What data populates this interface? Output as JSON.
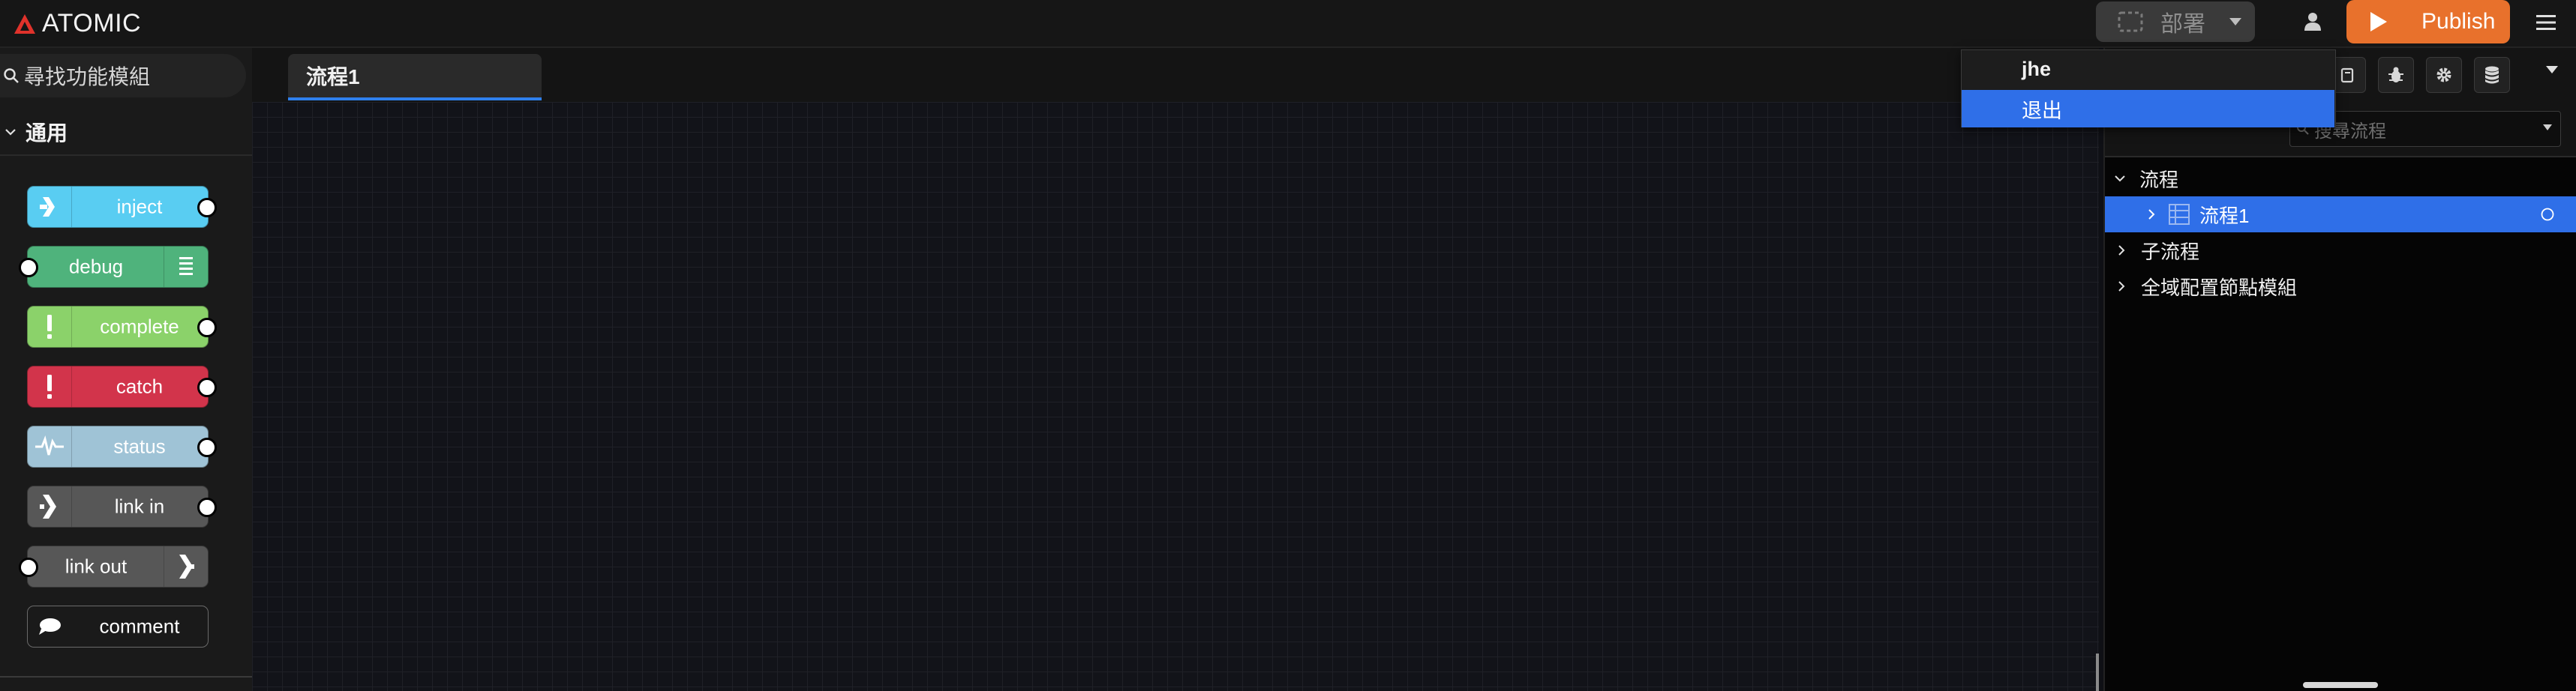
{
  "app": {
    "brand": "ATOMIC",
    "brand_icon": "triangle-logo-icon",
    "accent_color": "#e8712c",
    "selection_color": "#2f6fe8"
  },
  "header": {
    "deploy_label": "部署",
    "publish_label": "Publish"
  },
  "palette": {
    "search_placeholder": "尋找功能模組",
    "category_label": "通用",
    "nodes": [
      {
        "label": "inject",
        "color": "#59cdf2",
        "icon": "inject-arrow-icon"
      },
      {
        "label": "debug",
        "color": "#4fb37c",
        "icon": "debug-list-icon"
      },
      {
        "label": "complete",
        "color": "#8bd26a",
        "icon": "exclamation-icon"
      },
      {
        "label": "catch",
        "color": "#d2344b",
        "icon": "exclamation-icon"
      },
      {
        "label": "status",
        "color": "#9fc3d6",
        "icon": "pulse-icon"
      },
      {
        "label": "link in",
        "color": "#575757",
        "icon": "link-arrow-icon"
      },
      {
        "label": "link out",
        "color": "#575757",
        "icon": "link-arrow-icon"
      },
      {
        "label": "comment",
        "color": "#1a1a1a",
        "icon": "speech-bubble-icon"
      }
    ]
  },
  "workspace": {
    "tab_label": "流程1"
  },
  "sidebar": {
    "search_placeholder": "搜尋流程",
    "tree": {
      "root_label": "流程",
      "flow_item_label": "流程1",
      "subflow_label": "子流程",
      "config_label": "全域配置節點模組"
    }
  },
  "user_menu": {
    "username": "jhe",
    "logout_label": "退出"
  }
}
